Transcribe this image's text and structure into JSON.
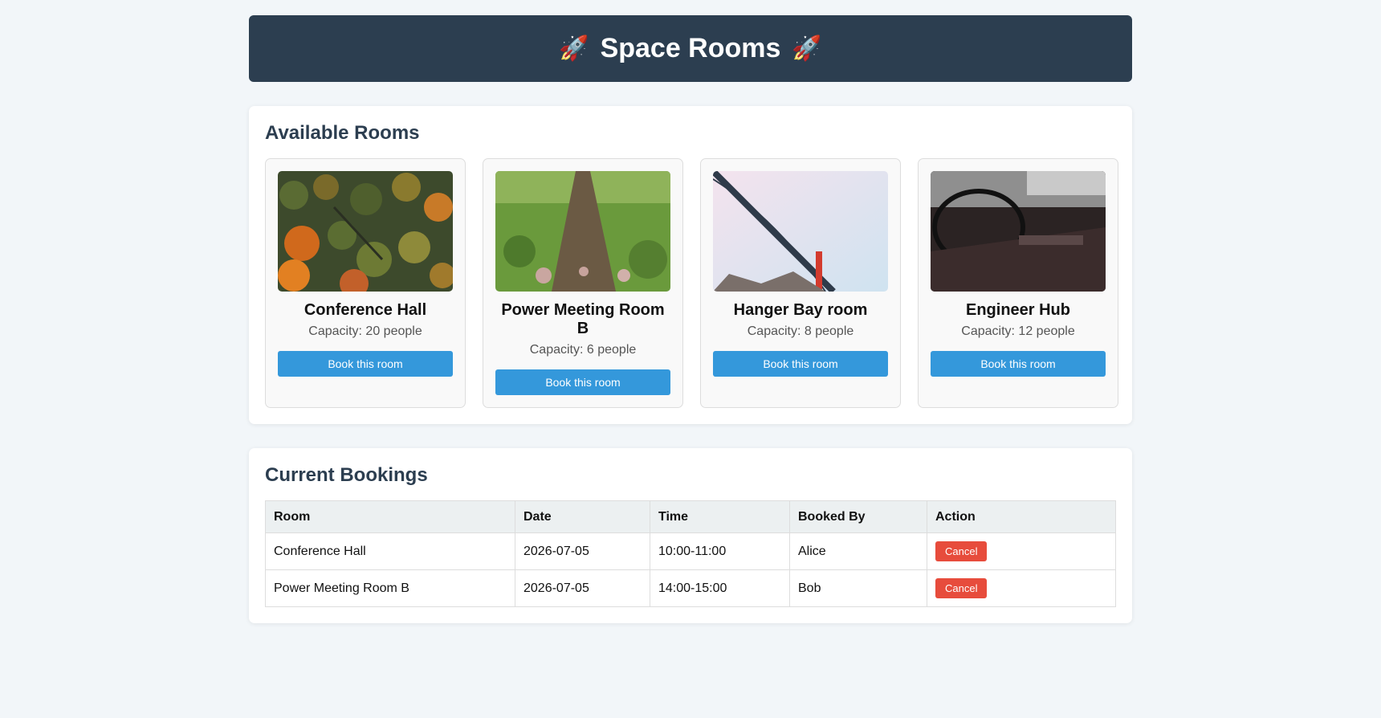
{
  "header": {
    "title": "Space Rooms",
    "left_icon": "rocket-icon",
    "right_icon": "rocket-icon"
  },
  "rooms_section": {
    "title": "Available Rooms",
    "rooms": [
      {
        "name": "Conference Hall",
        "capacity": "Capacity: 20 people",
        "button": "Book this room",
        "image": "forest-aerial-photo"
      },
      {
        "name": "Power Meeting Room B",
        "capacity": "Capacity: 6 people",
        "button": "Book this room",
        "image": "grass-path-photo"
      },
      {
        "name": "Hanger Bay room",
        "capacity": "Capacity: 8 people",
        "button": "Book this room",
        "image": "bridge-photo"
      },
      {
        "name": "Engineer Hub",
        "capacity": "Capacity: 12 people",
        "button": "Book this room",
        "image": "car-interior-photo"
      }
    ]
  },
  "bookings_section": {
    "title": "Current Bookings",
    "columns": [
      "Room",
      "Date",
      "Time",
      "Booked By",
      "Action"
    ],
    "rows": [
      {
        "room": "Conference Hall",
        "date": "2026-07-05",
        "time": "10:00-11:00",
        "booked_by": "Alice",
        "action": "Cancel"
      },
      {
        "room": "Power Meeting Room B",
        "date": "2026-07-05",
        "time": "14:00-15:00",
        "booked_by": "Bob",
        "action": "Cancel"
      }
    ]
  },
  "colors": {
    "header_bg": "#2c3e50",
    "primary": "#3498db",
    "danger": "#e74c3c"
  }
}
